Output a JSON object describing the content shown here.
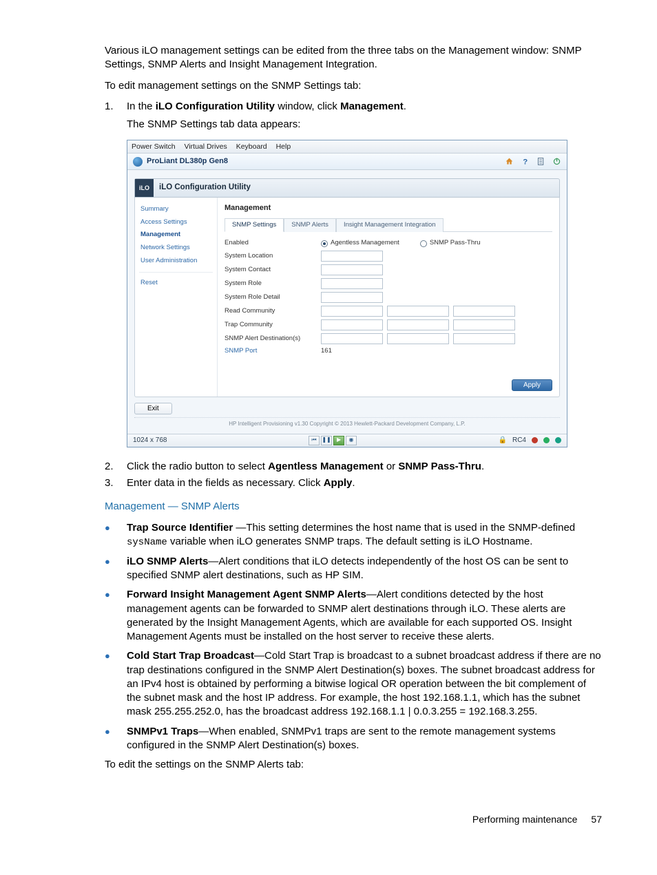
{
  "intro_p1": "Various iLO management settings can be edited from the three tabs on the Management window: SNMP Settings, SNMP Alerts and Insight Management Integration.",
  "intro_p2": "To edit management settings on the SNMP Settings tab:",
  "step1_prefix": "In the ",
  "step1_bold1": "iLO Configuration Utility",
  "step1_mid": " window, click ",
  "step1_bold2": "Management",
  "step1_suffix": ".",
  "step1_sub": "The SNMP Settings tab data appears:",
  "step2_prefix": "Click the radio button to select ",
  "step2_bold1": "Agentless Management",
  "step2_mid": " or ",
  "step2_bold2": "SNMP Pass-Thru",
  "step2_suffix": ".",
  "step3_prefix": "Enter data in the fields as necessary. Click ",
  "step3_bold": "Apply",
  "step3_suffix": ".",
  "section_heading": "Management — SNMP Alerts",
  "bullets": {
    "b1_bold": "Trap Source Identifier",
    "b1_t1": " —This setting determines the host name that is used in the SNMP-defined ",
    "b1_code": "sysName",
    "b1_t2": " variable when iLO generates SNMP traps. The default setting is iLO Hostname.",
    "b2_bold": "iLO SNMP Alerts",
    "b2_t": "—Alert conditions that iLO detects independently of the host OS can be sent to specified SNMP alert destinations, such as HP SIM.",
    "b3_bold": "Forward Insight Management Agent SNMP Alerts",
    "b3_t": "—Alert conditions detected by the host management agents can be forwarded to SNMP alert destinations through iLO. These alerts are generated by the Insight Management Agents, which are available for each supported OS. Insight Management Agents must be installed on the host server to receive these alerts.",
    "b4_bold": "Cold Start Trap Broadcast",
    "b4_t": "—Cold Start Trap is broadcast to a subnet broadcast address if there are no trap destinations configured in the SNMP Alert Destination(s) boxes. The subnet broadcast address for an IPv4 host is obtained by performing a bitwise logical OR operation between the bit complement of the subnet mask and the host IP address. For example, the host 192.168.1.1, which has the subnet mask 255.255.252.0, has the broadcast address 192.168.1.1 | 0.0.3.255 = 192.168.3.255.",
    "b5_bold": "SNMPv1 Traps",
    "b5_t": "—When enabled, SNMPv1 traps are sent to the remote management systems configured in the SNMP Alert Destination(s) boxes."
  },
  "closing": "To edit the settings on the SNMP Alerts tab:",
  "footer_section": "Performing maintenance",
  "footer_page": "57",
  "shot": {
    "menubar": [
      "Power Switch",
      "Virtual Drives",
      "Keyboard",
      "Help"
    ],
    "title": "ProLiant DL380p Gen8",
    "utility_title": "iLO Configuration Utility",
    "ilo_badge": "iLO",
    "sidebar": {
      "group1": [
        "Summary",
        "Access Settings",
        "Management",
        "Network Settings",
        "User Administration"
      ],
      "group2": [
        "Reset"
      ],
      "active": "Management"
    },
    "content_title": "Management",
    "tabs": [
      "SNMP Settings",
      "SNMP Alerts",
      "Insight Management Integration"
    ],
    "active_tab": "SNMP Settings",
    "rows": {
      "enabled": "Enabled",
      "radio1": "Agentless Management",
      "radio2": "SNMP Pass-Thru",
      "system_location": "System Location",
      "system_contact": "System Contact",
      "system_role": "System Role",
      "system_role_detail": "System Role Detail",
      "read_community": "Read Community",
      "trap_community": "Trap Community",
      "snmp_alert_dest": "SNMP Alert Destination(s)",
      "snmp_port": "SNMP Port",
      "snmp_port_value": "161"
    },
    "apply": "Apply",
    "exit": "Exit",
    "copyright": "HP Intelligent Provisioning v1.30 Copyright © 2013 Hewlett-Packard Development Company, L.P.",
    "status_res": "1024 x 768",
    "status_enc": "RC4"
  }
}
